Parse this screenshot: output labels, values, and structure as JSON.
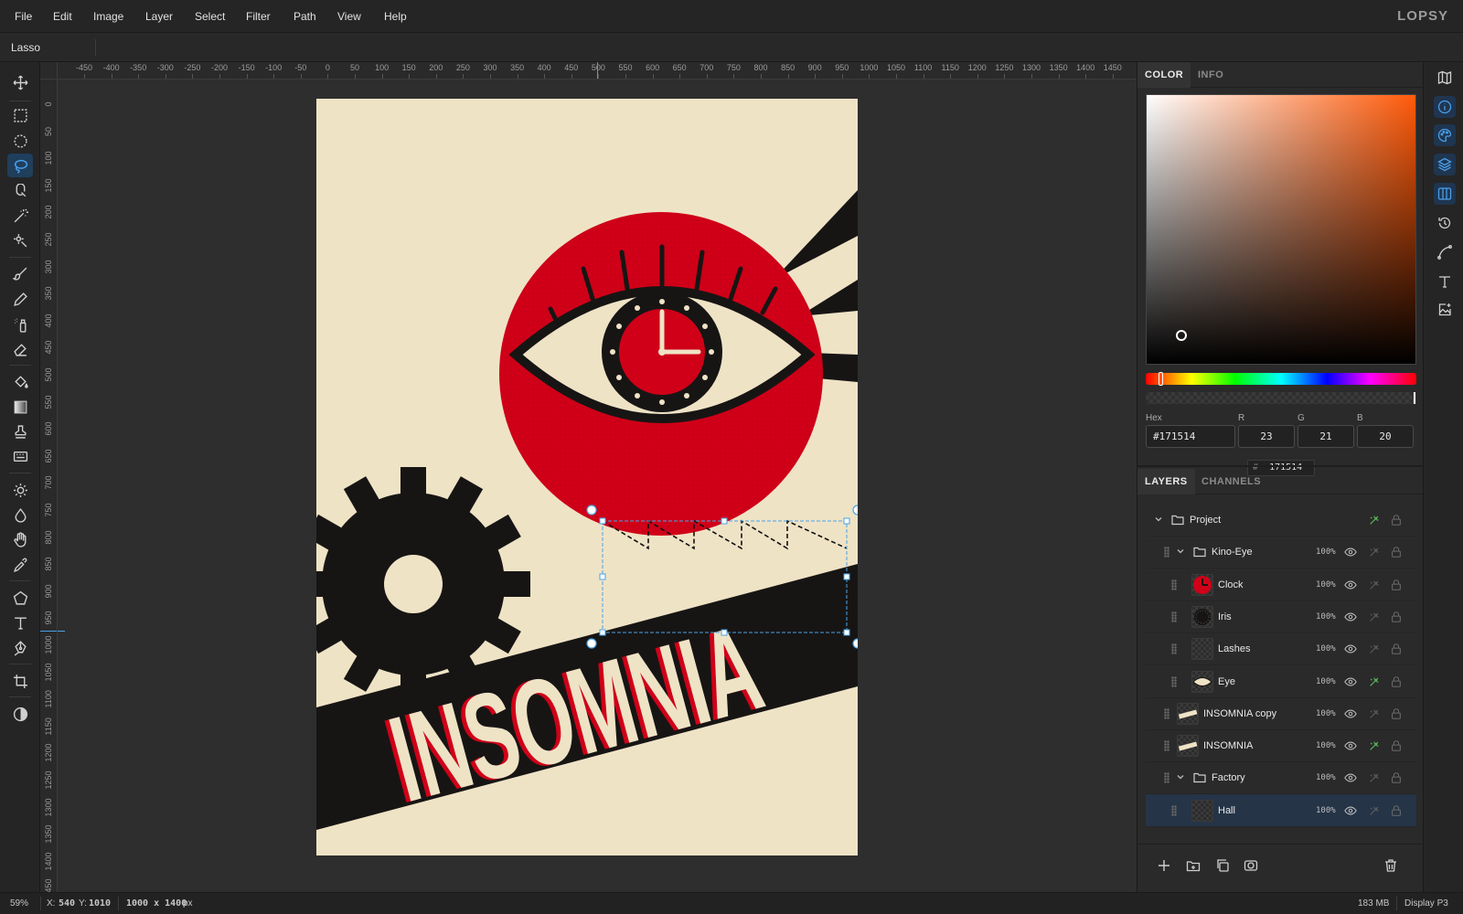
{
  "menu": {
    "items": [
      "File",
      "Edit",
      "Image",
      "Layer",
      "Select",
      "Filter",
      "Path",
      "View",
      "Help"
    ],
    "brand": "LOPSY"
  },
  "options_bar": {
    "tool_name": "Lasso"
  },
  "toolbar": {
    "tools": [
      {
        "name": "move-tool",
        "icon": "move-icon"
      },
      {
        "name": "rect-marquee-tool",
        "icon": "rect-select-icon"
      },
      {
        "name": "ellipse-marquee-tool",
        "icon": "ellipse-select-icon"
      },
      {
        "name": "lasso-tool",
        "icon": "lasso-icon",
        "active": true
      },
      {
        "name": "magnetic-lasso-tool",
        "icon": "magnet-lasso-icon"
      },
      {
        "name": "magic-wand-tool",
        "icon": "magic-wand-icon"
      },
      {
        "name": "quick-select-tool",
        "icon": "quick-select-icon"
      },
      {
        "name": "brush-tool",
        "icon": "brush-icon"
      },
      {
        "name": "pencil-tool",
        "icon": "pencil-icon"
      },
      {
        "name": "spray-tool",
        "icon": "spray-icon"
      },
      {
        "name": "eraser-tool",
        "icon": "eraser-icon"
      },
      {
        "name": "fill-tool",
        "icon": "paint-bucket-icon"
      },
      {
        "name": "gradient-tool",
        "icon": "gradient-icon"
      },
      {
        "name": "stamp-tool",
        "icon": "clone-stamp-icon"
      },
      {
        "name": "pattern-tool",
        "icon": "pattern-icon"
      },
      {
        "name": "dodge-tool",
        "icon": "sun-icon"
      },
      {
        "name": "blur-tool",
        "icon": "drop-icon"
      },
      {
        "name": "smudge-tool",
        "icon": "hand-icon"
      },
      {
        "name": "eyedropper-tool",
        "icon": "eyedropper-icon"
      },
      {
        "name": "shape-tool",
        "icon": "pentagon-icon"
      },
      {
        "name": "type-tool",
        "icon": "type-icon"
      },
      {
        "name": "pen-tool",
        "icon": "pen-icon"
      },
      {
        "name": "crop-tool",
        "icon": "crop-icon"
      },
      {
        "name": "mask-mode",
        "icon": "contrast-icon"
      }
    ]
  },
  "rulers": {
    "top": [
      "-450",
      "-400",
      "-350",
      "-300",
      "-250",
      "-200",
      "-150",
      "-100",
      "-50",
      "0",
      "50",
      "100",
      "150",
      "200",
      "250",
      "300",
      "350",
      "400",
      "450",
      "500",
      "550",
      "600",
      "650",
      "700",
      "750",
      "800",
      "850",
      "900",
      "950",
      "1000",
      "1050",
      "1100",
      "1150",
      "1200",
      "1250",
      "1300",
      "1350",
      "1400",
      "1450"
    ],
    "left": [
      "0",
      "50",
      "100",
      "150",
      "200",
      "250",
      "300",
      "350",
      "400",
      "450",
      "500",
      "550",
      "600",
      "650",
      "700",
      "750",
      "800",
      "850",
      "900",
      "950",
      "1000",
      "1050",
      "1100",
      "1150",
      "1200",
      "1250",
      "1300",
      "1350",
      "1400",
      "1450"
    ]
  },
  "artwork": {
    "title_text": "INSOMNIA",
    "colors": {
      "paper": "#efe3c6",
      "red": "#cf0018",
      "ink": "#171514"
    }
  },
  "color_panel": {
    "tabs": [
      "COLOR",
      "INFO"
    ],
    "active_tab": "COLOR",
    "labels": {
      "hex": "Hex",
      "r": "R",
      "g": "G",
      "b": "B"
    },
    "hex": "#171514",
    "r": "23",
    "g": "21",
    "b": "20",
    "hex_short": "171514",
    "hex_prefix": "#"
  },
  "layers_panel": {
    "tabs": [
      "LAYERS",
      "CHANNELS"
    ],
    "active_tab": "LAYERS",
    "rows": [
      {
        "name": "Project",
        "kind": "group",
        "indent": 0,
        "opacity": "",
        "visible_icon": false,
        "effect_on": true
      },
      {
        "name": "Kino-Eye",
        "kind": "group",
        "indent": 1,
        "opacity": "100%",
        "effect_on": false
      },
      {
        "name": "Clock",
        "kind": "layer",
        "indent": 2,
        "opacity": "100%",
        "effect_on": false
      },
      {
        "name": "Iris",
        "kind": "layer",
        "indent": 2,
        "opacity": "100%",
        "effect_on": false
      },
      {
        "name": "Lashes",
        "kind": "layer",
        "indent": 2,
        "opacity": "100%",
        "effect_on": false
      },
      {
        "name": "Eye",
        "kind": "layer",
        "indent": 2,
        "opacity": "100%",
        "effect_on": true
      },
      {
        "name": "INSOMNIA copy",
        "kind": "layer",
        "indent": 1,
        "opacity": "100%",
        "effect_on": false
      },
      {
        "name": "INSOMNIA",
        "kind": "layer",
        "indent": 1,
        "opacity": "100%",
        "effect_on": true
      },
      {
        "name": "Factory",
        "kind": "group",
        "indent": 1,
        "opacity": "100%",
        "effect_on": false
      },
      {
        "name": "Hall",
        "kind": "layer",
        "indent": 2,
        "opacity": "100%",
        "effect_on": false,
        "selected": true
      }
    ]
  },
  "status": {
    "zoom": "59%",
    "x_label": "X:",
    "x": "540",
    "y_label": "Y:",
    "y": "1010",
    "doc_size": "1000 x 1400",
    "doc_unit": "px",
    "memory": "183 MB",
    "color_profile": "Display P3"
  }
}
